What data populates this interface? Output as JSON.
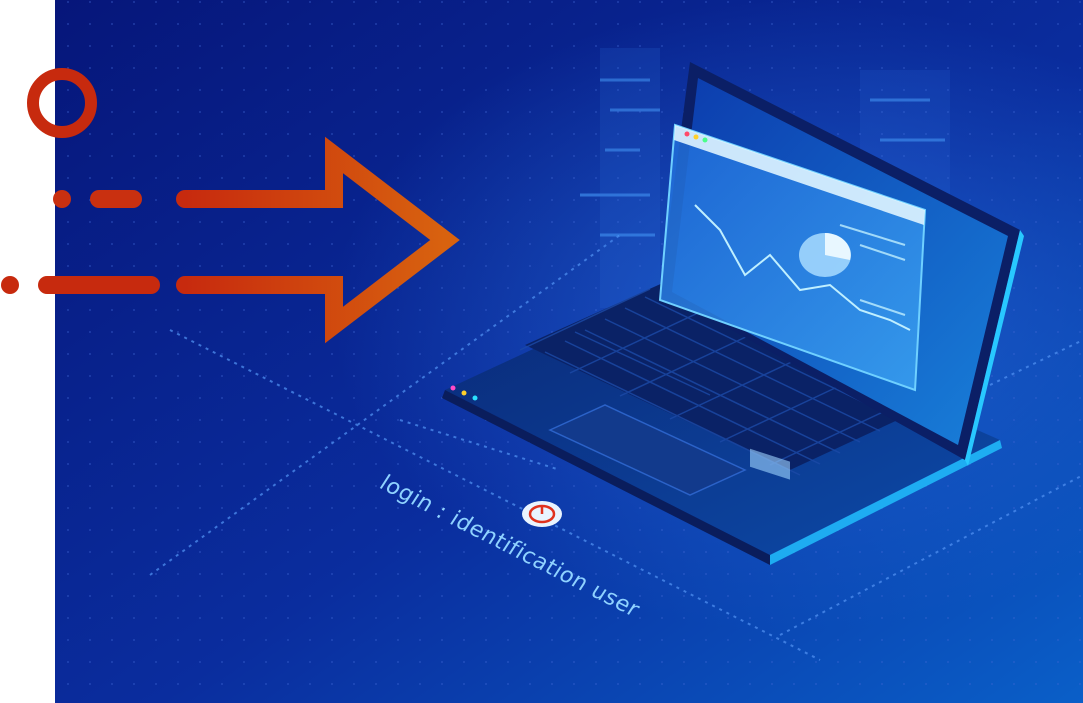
{
  "illustration": {
    "caption": "login : identification user",
    "colors": {
      "background_dark": "#06167a",
      "background_light": "#0a5fc8",
      "arrow_start": "#c72a0e",
      "arrow_end": "#d8620f",
      "glow": "#33c6ff",
      "power_red": "#e0321e"
    },
    "icons": [
      "circle-icon",
      "arrow-right-icon",
      "laptop-icon",
      "power-icon"
    ]
  }
}
